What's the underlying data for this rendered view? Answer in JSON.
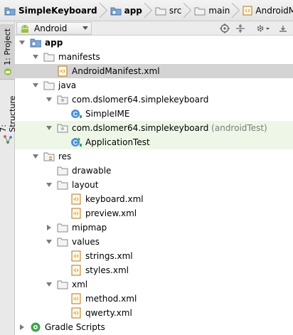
{
  "breadcrumb": {
    "items": [
      {
        "label": "SimpleKeyboard",
        "icon": "project-folder-icon"
      },
      {
        "label": "app",
        "icon": "module-folder-icon"
      },
      {
        "label": "src",
        "icon": "folder-icon"
      },
      {
        "label": "main",
        "icon": "folder-icon"
      },
      {
        "label": "AndroidManifest.xml",
        "icon": "xml-file-icon"
      }
    ]
  },
  "toolwindow_tabs": [
    {
      "label": "1: Project",
      "active": true
    },
    {
      "label": "7: Structure",
      "active": false
    }
  ],
  "toolbar": {
    "view_mode": "Android",
    "icons": [
      "target-icon",
      "collapse-all-icon",
      "settings-gear-icon",
      "hide-panel-icon"
    ]
  },
  "tree": [
    {
      "label": "app",
      "depth": 0,
      "icon": "module-folder-icon",
      "expanded": true
    },
    {
      "label": "manifests",
      "depth": 1,
      "icon": "folder-icon",
      "expanded": true
    },
    {
      "label": "AndroidManifest.xml",
      "depth": 2,
      "icon": "xml-file-icon",
      "selected": true
    },
    {
      "label": "java",
      "depth": 1,
      "icon": "folder-icon",
      "expanded": true
    },
    {
      "label": "com.dslomer64.simplekeyboard",
      "depth": 2,
      "icon": "package-icon",
      "expanded": true
    },
    {
      "label": "SimpleIME",
      "depth": 3,
      "icon": "class-icon"
    },
    {
      "label": "com.dslomer64.simplekeyboard",
      "suffix": "(androidTest)",
      "depth": 2,
      "icon": "package-icon",
      "expanded": true,
      "highlighted": true
    },
    {
      "label": "ApplicationTest",
      "depth": 3,
      "icon": "test-class-icon",
      "highlighted": true
    },
    {
      "label": "res",
      "depth": 1,
      "icon": "resources-folder-icon",
      "expanded": true
    },
    {
      "label": "drawable",
      "depth": 2,
      "icon": "folder-icon"
    },
    {
      "label": "layout",
      "depth": 2,
      "icon": "folder-icon",
      "expanded": true
    },
    {
      "label": "keyboard.xml",
      "depth": 3,
      "icon": "xml-file-icon"
    },
    {
      "label": "preview.xml",
      "depth": 3,
      "icon": "xml-file-icon"
    },
    {
      "label": "mipmap",
      "depth": 2,
      "icon": "folder-icon",
      "expanded": false
    },
    {
      "label": "values",
      "depth": 2,
      "icon": "folder-icon",
      "expanded": true
    },
    {
      "label": "strings.xml",
      "depth": 3,
      "icon": "xml-file-icon"
    },
    {
      "label": "styles.xml",
      "depth": 3,
      "icon": "xml-file-icon"
    },
    {
      "label": "xml",
      "depth": 2,
      "icon": "folder-icon",
      "expanded": true
    },
    {
      "label": "method.xml",
      "depth": 3,
      "icon": "xml-file-icon"
    },
    {
      "label": "qwerty.xml",
      "depth": 3,
      "icon": "xml-file-icon"
    },
    {
      "label": "Gradle Scripts",
      "depth": 0,
      "icon": "gradle-icon",
      "expanded": false
    }
  ],
  "colors": {
    "folder": "#7ea8d2",
    "package": "#b8b8b8",
    "xml": "#e8a038",
    "class_badge": "#4a90d9",
    "accent_green": "#3fa34d",
    "selected_row": "#d4d4d4",
    "highlight_row": "#eef7e7"
  }
}
